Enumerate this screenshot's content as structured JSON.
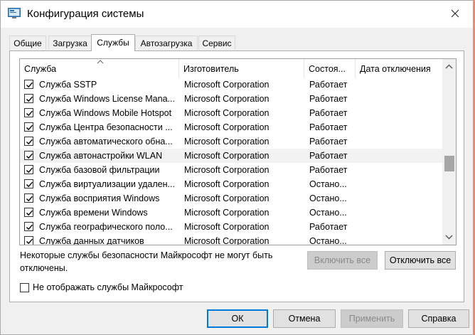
{
  "window": {
    "title": "Конфигурация системы"
  },
  "tabs": [
    {
      "label": "Общие"
    },
    {
      "label": "Загрузка"
    },
    {
      "label": "Службы"
    },
    {
      "label": "Автозагрузка"
    },
    {
      "label": "Сервис"
    }
  ],
  "active_tab": "Службы",
  "table": {
    "columns": [
      "Служба",
      "Изготовитель",
      "Состоя...",
      "Дата отключения"
    ],
    "rows": [
      {
        "name": "Служба SSTP",
        "vendor": "Microsoft Corporation",
        "status": "Работает",
        "date": "",
        "checked": true
      },
      {
        "name": "Служба Windows License Mana...",
        "vendor": "Microsoft Corporation",
        "status": "Работает",
        "date": "",
        "checked": true
      },
      {
        "name": "Служба Windows Mobile Hotspot",
        "vendor": "Microsoft Corporation",
        "status": "Работает",
        "date": "",
        "checked": true
      },
      {
        "name": "Служба Центра безопасности ...",
        "vendor": "Microsoft Corporation",
        "status": "Работает",
        "date": "",
        "checked": true
      },
      {
        "name": "Служба автоматического обна...",
        "vendor": "Microsoft Corporation",
        "status": "Работает",
        "date": "",
        "checked": true
      },
      {
        "name": "Служба автонастройки WLAN",
        "vendor": "Microsoft Corporation",
        "status": "Работает",
        "date": "",
        "checked": true
      },
      {
        "name": "Служба базовой фильтрации",
        "vendor": "Microsoft Corporation",
        "status": "Работает",
        "date": "",
        "checked": true
      },
      {
        "name": "Служба виртуализации удален...",
        "vendor": "Microsoft Corporation",
        "status": "Остано...",
        "date": "",
        "checked": true
      },
      {
        "name": "Служба восприятия Windows",
        "vendor": "Microsoft Corporation",
        "status": "Остано...",
        "date": "",
        "checked": true
      },
      {
        "name": "Служба времени Windows",
        "vendor": "Microsoft Corporation",
        "status": "Остано...",
        "date": "",
        "checked": true
      },
      {
        "name": "Служба географического поло...",
        "vendor": "Microsoft Corporation",
        "status": "Работает",
        "date": "",
        "checked": true
      },
      {
        "name": "Служба данных датчиков",
        "vendor": "Microsoft Corporation",
        "status": "Остано...",
        "date": "",
        "checked": true
      }
    ]
  },
  "note": "Некоторые службы безопасности Майкрософт не могут быть отключены.",
  "buttons": {
    "enable_all": "Включить все",
    "disable_all": "Отключить все",
    "ok": "ОК",
    "cancel": "Отмена",
    "apply": "Применить",
    "help": "Справка"
  },
  "hide_ms": {
    "label": "Не отображать службы Майкрософт",
    "checked": false
  },
  "colors": {
    "accent": "#0078d7",
    "desktop": "#e98a6e"
  }
}
